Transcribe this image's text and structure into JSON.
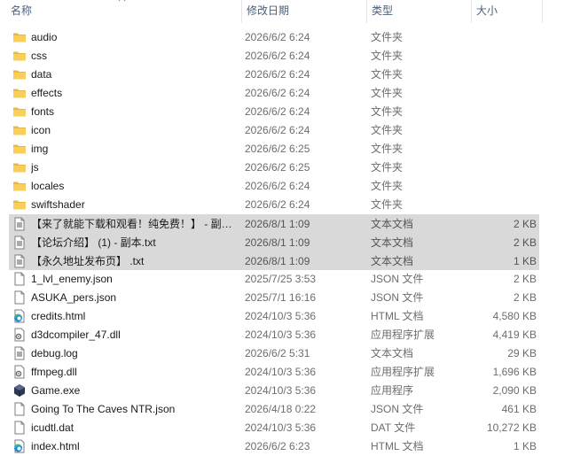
{
  "columns": {
    "name": "名称",
    "date": "修改日期",
    "type": "类型",
    "size": "大小"
  },
  "rows": [
    {
      "name": "audio",
      "date": "2026/6/2 6:24",
      "type": "文件夹",
      "size": "",
      "icon": "folder-icon",
      "selected": false
    },
    {
      "name": "css",
      "date": "2026/6/2 6:24",
      "type": "文件夹",
      "size": "",
      "icon": "folder-icon",
      "selected": false
    },
    {
      "name": "data",
      "date": "2026/6/2 6:24",
      "type": "文件夹",
      "size": "",
      "icon": "folder-icon",
      "selected": false
    },
    {
      "name": "effects",
      "date": "2026/6/2 6:24",
      "type": "文件夹",
      "size": "",
      "icon": "folder-icon",
      "selected": false
    },
    {
      "name": "fonts",
      "date": "2026/6/2 6:24",
      "type": "文件夹",
      "size": "",
      "icon": "folder-icon",
      "selected": false
    },
    {
      "name": "icon",
      "date": "2026/6/2 6:24",
      "type": "文件夹",
      "size": "",
      "icon": "folder-icon",
      "selected": false
    },
    {
      "name": "img",
      "date": "2026/6/2 6:25",
      "type": "文件夹",
      "size": "",
      "icon": "folder-icon",
      "selected": false
    },
    {
      "name": "js",
      "date": "2026/6/2 6:25",
      "type": "文件夹",
      "size": "",
      "icon": "folder-icon",
      "selected": false
    },
    {
      "name": "locales",
      "date": "2026/6/2 6:24",
      "type": "文件夹",
      "size": "",
      "icon": "folder-icon",
      "selected": false
    },
    {
      "name": "swiftshader",
      "date": "2026/6/2 6:24",
      "type": "文件夹",
      "size": "",
      "icon": "folder-icon",
      "selected": false
    },
    {
      "name": "【来了就能下载和观看！纯免费！】 - 副…",
      "date": "2026/8/1 1:09",
      "type": "文本文档",
      "size": "2 KB",
      "icon": "text-file-icon",
      "selected": true
    },
    {
      "name": "【论坛介绍】 (1) - 副本.txt",
      "date": "2026/8/1 1:09",
      "type": "文本文档",
      "size": "2 KB",
      "icon": "text-file-icon",
      "selected": true
    },
    {
      "name": "【永久地址发布页】 .txt",
      "date": "2026/8/1 1:09",
      "type": "文本文档",
      "size": "1 KB",
      "icon": "text-file-icon",
      "selected": true
    },
    {
      "name": "1_lvl_enemy.json",
      "date": "2025/7/25 3:53",
      "type": "JSON 文件",
      "size": "2 KB",
      "icon": "blank-file-icon",
      "selected": false
    },
    {
      "name": "ASUKA_pers.json",
      "date": "2025/7/1 16:16",
      "type": "JSON 文件",
      "size": "2 KB",
      "icon": "blank-file-icon",
      "selected": false
    },
    {
      "name": "credits.html",
      "date": "2024/10/3 5:36",
      "type": "HTML 文档",
      "size": "4,580 KB",
      "icon": "edge-html-icon",
      "selected": false
    },
    {
      "name": "d3dcompiler_47.dll",
      "date": "2024/10/3 5:36",
      "type": "应用程序扩展",
      "size": "4,419 KB",
      "icon": "dll-file-icon",
      "selected": false
    },
    {
      "name": "debug.log",
      "date": "2026/6/2 5:31",
      "type": "文本文档",
      "size": "29 KB",
      "icon": "text-file-icon",
      "selected": false
    },
    {
      "name": "ffmpeg.dll",
      "date": "2024/10/3 5:36",
      "type": "应用程序扩展",
      "size": "1,696 KB",
      "icon": "dll-file-icon",
      "selected": false
    },
    {
      "name": "Game.exe",
      "date": "2024/10/3 5:36",
      "type": "应用程序",
      "size": "2,090 KB",
      "icon": "game-exe-icon",
      "selected": false
    },
    {
      "name": "Going To The Caves NTR.json",
      "date": "2026/4/18 0:22",
      "type": "JSON 文件",
      "size": "461 KB",
      "icon": "blank-file-icon",
      "selected": false
    },
    {
      "name": "icudtl.dat",
      "date": "2024/10/3 5:36",
      "type": "DAT 文件",
      "size": "10,272 KB",
      "icon": "blank-file-icon",
      "selected": false
    },
    {
      "name": "index.html",
      "date": "2026/6/2 6:23",
      "type": "HTML 文档",
      "size": "1 KB",
      "icon": "edge-html-icon",
      "selected": false
    }
  ]
}
